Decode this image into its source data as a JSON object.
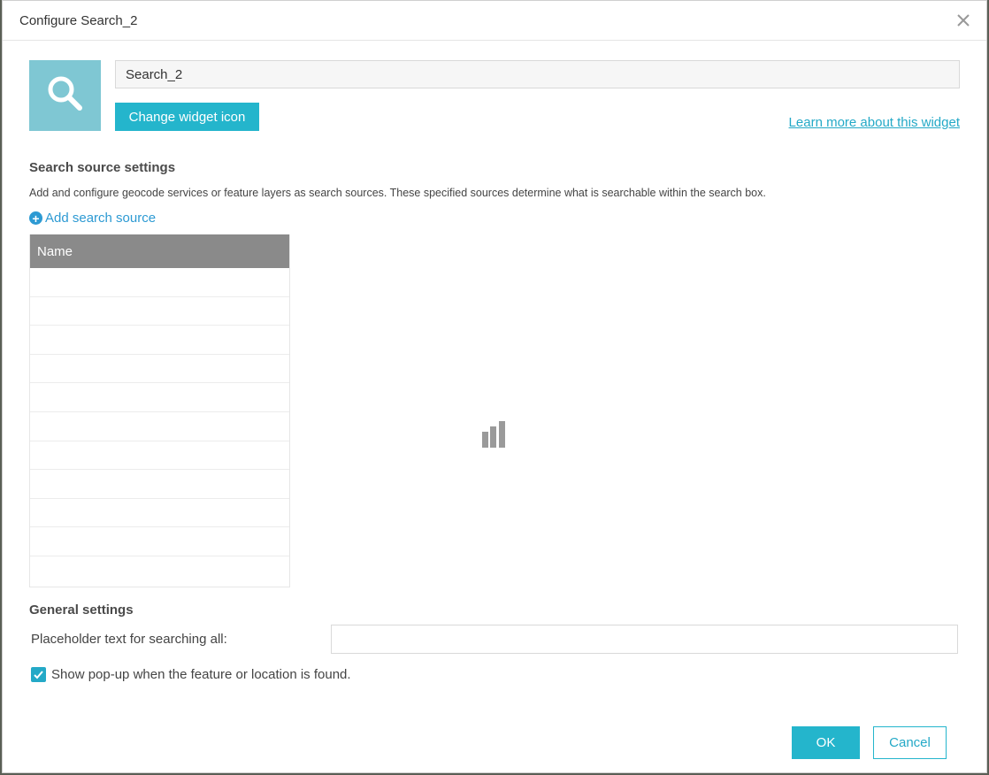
{
  "dialog": {
    "title": "Configure Search_2",
    "close_icon": "close-icon"
  },
  "widget": {
    "icon": "search-icon",
    "icon_bg_color": "#7fc7d3",
    "name_value": "Search_2",
    "change_icon_label": "Change widget icon",
    "learn_more_label": "Learn more about this widget"
  },
  "search_sources": {
    "section_title": "Search source settings",
    "description": "Add and configure geocode services or feature layers as search sources. These specified sources determine what is searchable within the search box.",
    "add_label": "Add search source",
    "table": {
      "columns": [
        "Name"
      ],
      "rows": []
    },
    "loading_icon": "loading-bars-icon"
  },
  "general": {
    "section_title": "General settings",
    "placeholder_label": "Placeholder text for searching all:",
    "placeholder_value": "",
    "popup_checkbox_label": "Show pop-up when the feature or location is found.",
    "popup_checked": true
  },
  "footer": {
    "ok_label": "OK",
    "cancel_label": "Cancel"
  },
  "colors": {
    "accent": "#24b5cc",
    "link": "#24a9c7",
    "header_gray": "#8a8a8a"
  }
}
